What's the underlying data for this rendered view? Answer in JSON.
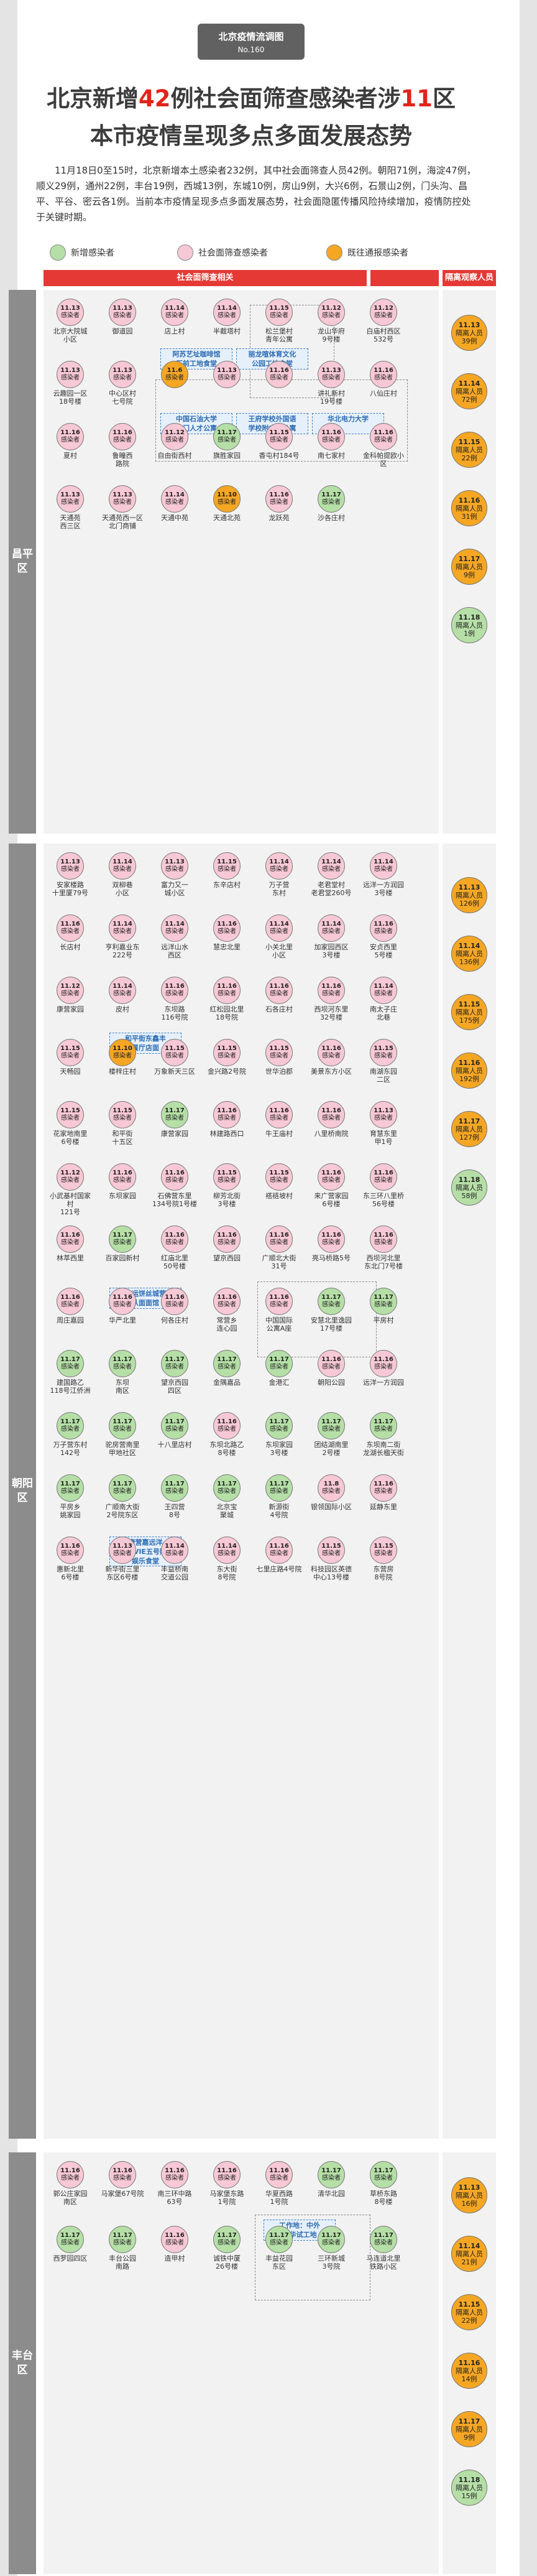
{
  "tag": {
    "title": "北京疫情流调图",
    "number": "No.160"
  },
  "headline": {
    "line1_a": "北京新增",
    "line1_n1": "42",
    "line1_b": "例社会面筛查感染者涉",
    "line1_n2": "11",
    "line1_c": "区",
    "line2": "本市疫情呈现多点多面发展态势"
  },
  "lead": "11月18日0至15时，北京新增本土感染者232例，其中社会面筛查人员42例。朝阳71例，海淀47例，顺义29例，通州22例，丰台19例，西城13例，东城10例，房山9例，大兴6例，石景山2例，门头沟、昌平、平谷、密云各1例。当前本市疫情呈现多点多面发展态势，社会面隐匿传播风险持续增加，疫情防控处于关键时期。",
  "legend": [
    {
      "label": "新增感染者",
      "color": "#b5dfa6"
    },
    {
      "label": "社会面筛查感染者",
      "color": "#f7c8d5"
    },
    {
      "label": "既往通报感染者",
      "color": "#f5a623"
    }
  ],
  "headers": {
    "society": "社会面筛查相关",
    "isolated": "隔离观察人员"
  },
  "districts": [
    {
      "name": "昌平区"
    },
    {
      "name": "朝阳区"
    },
    {
      "name": "丰台区"
    }
  ],
  "cells": [
    {
      "date": "11.13",
      "txt": "感染者",
      "label": "北京大院城\n小区",
      "c": "pink"
    },
    {
      "date": "11.13",
      "txt": "感染者",
      "label": "御道园",
      "c": "pink"
    },
    {
      "date": "11.14",
      "txt": "感染者",
      "label": "店上村",
      "c": "pink"
    },
    {
      "date": "11.14",
      "txt": "感染者",
      "label": "半截塔村",
      "c": "pink"
    },
    {
      "date": "11.15",
      "txt": "感染者",
      "label": "松兰堡村\n青年公寓",
      "c": "pink"
    },
    {
      "date": "11.12",
      "txt": "感染者",
      "label": "龙山华府\n9号楼",
      "c": "pink"
    },
    {
      "date": "11.12",
      "txt": "感染者",
      "label": "白庙村西区\n532号",
      "c": "pink"
    },
    {
      "date": "11.13",
      "txt": "感染者",
      "label": "云趣园一区\n18号楼",
      "c": "pink"
    },
    {
      "date": "11.13",
      "txt": "感染者",
      "label": "中心区村\n七号院",
      "c": "pink"
    },
    {
      "date": "11.6",
      "txt": "感染者",
      "label": "",
      "c": "orange"
    },
    {
      "date": "11.13",
      "txt": "感染者",
      "label": "",
      "c": "pink"
    },
    {
      "date": "11.16",
      "txt": "感染者",
      "label": "",
      "c": "pink"
    },
    {
      "date": "11.13",
      "txt": "感染者",
      "label": "讲礼新村\n19号楼",
      "c": "pink"
    },
    {
      "date": "11.16",
      "txt": "感染者",
      "label": "八仙庄村",
      "c": "pink"
    },
    {
      "date": "11.16",
      "txt": "感染者",
      "label": "夏村",
      "c": "pink"
    },
    {
      "date": "11.16",
      "txt": "感染者",
      "label": "鲁疃西\n路院",
      "c": "pink"
    },
    {
      "date": "11.12",
      "txt": "感染者",
      "label": "自由街西村",
      "c": "pink"
    },
    {
      "date": "11.17",
      "txt": "感染者",
      "label": "旗胜家园",
      "c": "green"
    },
    {
      "date": "11.15",
      "txt": "感染者",
      "label": "香屯村184号",
      "c": "pink"
    },
    {
      "date": "11.16",
      "txt": "感染者",
      "label": "南七家村",
      "c": "pink"
    },
    {
      "date": "11.16",
      "txt": "感染者",
      "label": "金科帕提欧小区",
      "c": "pink"
    },
    {
      "date": "11.13",
      "txt": "感染者",
      "label": "天通苑\n西三区",
      "c": "pink"
    },
    {
      "date": "11.13",
      "txt": "感染者",
      "label": "天通苑西一区\n北门商铺",
      "c": "pink"
    },
    {
      "date": "11.14",
      "txt": "感染者",
      "label": "天通中苑",
      "c": "pink"
    },
    {
      "date": "11.10",
      "txt": "感染者",
      "label": "天通北苑",
      "c": "orange"
    },
    {
      "date": "11.16",
      "txt": "感染者",
      "label": "龙跃苑",
      "c": "pink"
    },
    {
      "date": "11.17",
      "txt": "感染者",
      "label": "沙各庄村",
      "c": "green"
    },
    {
      "date": "11.13",
      "txt": "感染者",
      "label": "安家楼路\n十里厦79号",
      "c": "pink"
    },
    {
      "date": "11.14",
      "txt": "感染者",
      "label": "双柳巷\n小区",
      "c": "pink"
    },
    {
      "date": "11.13",
      "txt": "感染者",
      "label": "富力又一\n城小区",
      "c": "pink"
    },
    {
      "date": "11.15",
      "txt": "感染者",
      "label": "东辛店村",
      "c": "pink"
    },
    {
      "date": "11.14",
      "txt": "感染者",
      "label": "万子营\n东村",
      "c": "pink"
    },
    {
      "date": "11.14",
      "txt": "感染者",
      "label": "老君堂村\n老君堂260号",
      "c": "pink"
    },
    {
      "date": "11.14",
      "txt": "感染者",
      "label": "远洋一方润园\n3号楼",
      "c": "pink"
    },
    {
      "date": "11.16",
      "txt": "感染者",
      "label": "长店村",
      "c": "pink"
    },
    {
      "date": "11.14",
      "txt": "感染者",
      "label": "亨利嘉业东\n222号",
      "c": "pink"
    },
    {
      "date": "11.14",
      "txt": "感染者",
      "label": "远洋山水\n西区",
      "c": "pink"
    },
    {
      "date": "11.16",
      "txt": "感染者",
      "label": "慧忠北里",
      "c": "pink"
    },
    {
      "date": "11.14",
      "txt": "感染者",
      "label": "小关北里\n小区",
      "c": "pink"
    },
    {
      "date": "11.14",
      "txt": "感染者",
      "label": "加家园西区\n3号楼",
      "c": "pink"
    },
    {
      "date": "11.16",
      "txt": "感染者",
      "label": "安贞西里\n5号楼",
      "c": "pink"
    },
    {
      "date": "11.12",
      "txt": "感染者",
      "label": "康营家园",
      "c": "pink"
    },
    {
      "date": "11.14",
      "txt": "感染者",
      "label": "皮村",
      "c": "pink"
    },
    {
      "date": "11.16",
      "txt": "感染者",
      "label": "东坝路\n116号院",
      "c": "pink"
    },
    {
      "date": "11.16",
      "txt": "感染者",
      "label": "红松园北里\n18号院",
      "c": "pink"
    },
    {
      "date": "11.16",
      "txt": "感染者",
      "label": "石各庄村",
      "c": "pink"
    },
    {
      "date": "11.16",
      "txt": "感染者",
      "label": "西坝河东里\n32号楼",
      "c": "pink"
    },
    {
      "date": "11.14",
      "txt": "感染者",
      "label": "南太子庄\n北巷",
      "c": "pink"
    },
    {
      "date": "11.15",
      "txt": "感染者",
      "label": "天畅园",
      "c": "pink"
    },
    {
      "date": "11.10",
      "txt": "感染者",
      "label": "楼梓庄村",
      "c": "orange"
    },
    {
      "date": "11.15",
      "txt": "感染者",
      "label": "万象新天三区",
      "c": "pink"
    },
    {
      "date": "11.15",
      "txt": "感染者",
      "label": "金兴路2号院",
      "c": "pink"
    },
    {
      "date": "11.15",
      "txt": "感染者",
      "label": "世华泊郡",
      "c": "pink"
    },
    {
      "date": "11.16",
      "txt": "感染者",
      "label": "美景东方小区",
      "c": "pink"
    },
    {
      "date": "11.15",
      "txt": "感染者",
      "label": "南湖东园\n二区",
      "c": "pink"
    },
    {
      "date": "11.15",
      "txt": "感染者",
      "label": "花家地南里\n6号楼",
      "c": "pink"
    },
    {
      "date": "11.15",
      "txt": "感染者",
      "label": "和平街\n十五区",
      "c": "pink"
    },
    {
      "date": "11.17",
      "txt": "感染者",
      "label": "康营家园",
      "c": "green"
    },
    {
      "date": "11.16",
      "txt": "感染者",
      "label": "林建路西口",
      "c": "pink"
    },
    {
      "date": "11.16",
      "txt": "感染者",
      "label": "牛王庙村",
      "c": "pink"
    },
    {
      "date": "11.16",
      "txt": "感染者",
      "label": "八里桥南院",
      "c": "pink"
    },
    {
      "date": "11.13",
      "txt": "感染者",
      "label": "育慧东里\n甲1号",
      "c": "pink"
    },
    {
      "date": "11.12",
      "txt": "感染者",
      "label": "小武基村国家村\n121号",
      "c": "pink"
    },
    {
      "date": "11.16",
      "txt": "感染者",
      "label": "东坝家园",
      "c": "pink"
    },
    {
      "date": "11.16",
      "txt": "感染者",
      "label": "石佛营东里\n134号院1号楼",
      "c": "pink"
    },
    {
      "date": "11.15",
      "txt": "感染者",
      "label": "柳芳北街\n3号楼",
      "c": "pink"
    },
    {
      "date": "11.15",
      "txt": "感染者",
      "label": "褡裢坡村",
      "c": "pink"
    },
    {
      "date": "11.16",
      "txt": "感染者",
      "label": "来广营家园\n6号楼",
      "c": "pink"
    },
    {
      "date": "11.16",
      "txt": "感染者",
      "label": "东三环八里桥\n56号楼",
      "c": "pink"
    },
    {
      "date": "11.16",
      "txt": "感染者",
      "label": "林萃西里",
      "c": "pink"
    },
    {
      "date": "11.17",
      "txt": "感染者",
      "label": "百家园新村",
      "c": "green"
    },
    {
      "date": "11.16",
      "txt": "感染者",
      "label": "红庙北里\n50号楼",
      "c": "pink"
    },
    {
      "date": "11.16",
      "txt": "感染者",
      "label": "望京西园",
      "c": "pink"
    },
    {
      "date": "11.16",
      "txt": "感染者",
      "label": "广顺北大街\n31号",
      "c": "pink"
    },
    {
      "date": "11.16",
      "txt": "感染者",
      "label": "亮马桥路5号",
      "c": "pink"
    },
    {
      "date": "11.16",
      "txt": "感染者",
      "label": "西坝河北里\n东北门7号楼",
      "c": "pink"
    },
    {
      "date": "11.16",
      "txt": "感染者",
      "label": "周庄嘉园",
      "c": "pink"
    },
    {
      "date": "11.16",
      "txt": "感染者",
      "label": "华严北里",
      "c": "pink"
    },
    {
      "date": "11.16",
      "txt": "感染者",
      "label": "何各庄村",
      "c": "pink"
    },
    {
      "date": "11.16",
      "txt": "感染者",
      "label": "常营乡\n连心园",
      "c": "pink"
    },
    {
      "date": "11.16",
      "txt": "感染者",
      "label": "中国国际\n公寓A座",
      "c": "pink"
    },
    {
      "date": "11.17",
      "txt": "感染者",
      "label": "安慧北里逸园\n17号楼",
      "c": "green"
    },
    {
      "date": "11.17",
      "txt": "感染者",
      "label": "平房村",
      "c": "green"
    },
    {
      "date": "11.17",
      "txt": "感染者",
      "label": "建国路乙\n118号江侨洲",
      "c": "green"
    },
    {
      "date": "11.17",
      "txt": "感染者",
      "label": "东坝\n南区",
      "c": "green"
    },
    {
      "date": "11.17",
      "txt": "感染者",
      "label": "望京西园\n四区",
      "c": "green"
    },
    {
      "date": "11.17",
      "txt": "感染者",
      "label": "金隅嘉品",
      "c": "green"
    },
    {
      "date": "11.17",
      "txt": "感染者",
      "label": "金港汇",
      "c": "green"
    },
    {
      "date": "11.16",
      "txt": "感染者",
      "label": "朝阳公园",
      "c": "pink"
    },
    {
      "date": "11.16",
      "txt": "感染者",
      "label": "远洋一方润园",
      "c": "pink"
    },
    {
      "date": "11.17",
      "txt": "感染者",
      "label": "万子营东村\n142号",
      "c": "green"
    },
    {
      "date": "11.17",
      "txt": "感染者",
      "label": "驼房营南里\n甲地社区",
      "c": "green"
    },
    {
      "date": "11.17",
      "txt": "感染者",
      "label": "十八里店村",
      "c": "green"
    },
    {
      "date": "11.16",
      "txt": "感染者",
      "label": "东坝北路乙\n8号楼",
      "c": "pink"
    },
    {
      "date": "11.17",
      "txt": "感染者",
      "label": "东坝家园\n3号楼",
      "c": "green"
    },
    {
      "date": "11.17",
      "txt": "感染者",
      "label": "团结湖南里\n2号楼",
      "c": "green"
    },
    {
      "date": "11.17",
      "txt": "感染者",
      "label": "东坝南二街\n龙湖长楹天街",
      "c": "green"
    },
    {
      "date": "11.17",
      "txt": "感染者",
      "label": "平房乡\n姚家园",
      "c": "green"
    },
    {
      "date": "11.17",
      "txt": "感染者",
      "label": "广顺南大街\n2号院东区",
      "c": "green"
    },
    {
      "date": "11.17",
      "txt": "感染者",
      "label": "王四营\n8号",
      "c": "green"
    },
    {
      "date": "11.17",
      "txt": "感染者",
      "label": "北京宝\n聚城",
      "c": "green"
    },
    {
      "date": "11.17",
      "txt": "感染者",
      "label": "新源街\n4号院",
      "c": "green"
    },
    {
      "date": "11.8",
      "txt": "感染者",
      "label": "银领国际小区",
      "c": "pink"
    },
    {
      "date": "11.16",
      "txt": "感染者",
      "label": "延静东里",
      "c": "pink"
    },
    {
      "date": "11.16",
      "txt": "感染者",
      "label": "惠新北里\n6号楼",
      "c": "pink"
    },
    {
      "date": "11.13",
      "txt": "感染者",
      "label": "新华街三里\n东区6号楼",
      "c": "pink"
    },
    {
      "date": "11.14",
      "txt": "感染者",
      "label": "丰益桥南\n交道公园",
      "c": "pink"
    },
    {
      "date": "11.14",
      "txt": "感染者",
      "label": "东大街\n8号院",
      "c": "pink"
    },
    {
      "date": "11.16",
      "txt": "感染者",
      "label": "七里庄路4号院",
      "c": "pink"
    },
    {
      "date": "11.15",
      "txt": "感染者",
      "label": "科技园区英德\n中心13号楼",
      "c": "pink"
    },
    {
      "date": "11.15",
      "txt": "感染者",
      "label": "东营房\n8号院",
      "c": "pink"
    },
    {
      "date": "11.16",
      "txt": "感染者",
      "label": "郭公庄家园\n南区",
      "c": "pink"
    },
    {
      "date": "11.16",
      "txt": "感染者",
      "label": "马家堡67号院",
      "c": "pink"
    },
    {
      "date": "11.16",
      "txt": "感染者",
      "label": "南三环中路\n63号",
      "c": "pink"
    },
    {
      "date": "11.16",
      "txt": "感染者",
      "label": "马家堡东路\n1号院",
      "c": "pink"
    },
    {
      "date": "11.16",
      "txt": "感染者",
      "label": "华夏西路\n1号院",
      "c": "pink"
    },
    {
      "date": "11.17",
      "txt": "感染者",
      "label": "清华北园",
      "c": "green"
    },
    {
      "date": "11.17",
      "txt": "感染者",
      "label": "草桥东路\n8号楼",
      "c": "green"
    },
    {
      "date": "11.17",
      "txt": "感染者",
      "label": "西罗园四区",
      "c": "green"
    },
    {
      "date": "11.17",
      "txt": "感染者",
      "label": "丰台公园\n南路",
      "c": "green"
    },
    {
      "date": "11.16",
      "txt": "感染者",
      "label": "造甲村",
      "c": "pink"
    },
    {
      "date": "11.17",
      "txt": "感染者",
      "label": "诚铁中厦\n26号楼",
      "c": "green"
    },
    {
      "date": "11.17",
      "txt": "感染者",
      "label": "丰益花园\n东区",
      "c": "green"
    },
    {
      "date": "11.17",
      "txt": "感染者",
      "label": "三环新城\n3号院",
      "c": "green"
    },
    {
      "date": "11.17",
      "txt": "感染者",
      "label": "马连道北里\n铁路小区",
      "c": "green"
    }
  ],
  "iso": [
    {
      "date": "11.13",
      "txt": "隔离人员\n39例",
      "c": "orange"
    },
    {
      "date": "11.14",
      "txt": "隔离人员\n72例",
      "c": "orange"
    },
    {
      "date": "11.15",
      "txt": "隔离人员\n22例",
      "c": "orange"
    },
    {
      "date": "11.16",
      "txt": "隔离人员\n31例",
      "c": "orange"
    },
    {
      "date": "11.17",
      "txt": "隔离人员\n9例",
      "c": "orange"
    },
    {
      "date": "11.18",
      "txt": "隔离人员\n1例",
      "c": "green"
    },
    {
      "date": "11.13",
      "txt": "隔离人员\n126例",
      "c": "orange"
    },
    {
      "date": "11.14",
      "txt": "隔离人员\n136例",
      "c": "orange"
    },
    {
      "date": "11.15",
      "txt": "隔离人员\n175例",
      "c": "orange"
    },
    {
      "date": "11.16",
      "txt": "隔离人员\n192例",
      "c": "orange"
    },
    {
      "date": "11.17",
      "txt": "隔离人员\n127例",
      "c": "orange"
    },
    {
      "date": "11.18",
      "txt": "隔离人员\n58例",
      "c": "green"
    },
    {
      "date": "11.13",
      "txt": "隔离人员\n16例",
      "c": "orange"
    },
    {
      "date": "11.14",
      "txt": "隔离人员\n21例",
      "c": "orange"
    },
    {
      "date": "11.15",
      "txt": "隔离人员\n22例",
      "c": "orange"
    },
    {
      "date": "11.16",
      "txt": "隔离人员\n14例",
      "c": "orange"
    },
    {
      "date": "11.17",
      "txt": "隔离人员\n9例",
      "c": "orange"
    },
    {
      "date": "11.18",
      "txt": "隔离人员\n15例",
      "c": "green"
    }
  ],
  "workplaces": [
    "阿苏艺址咖啡馆\n厂前工地食堂",
    "丽龙喧体育文化\n公园工地食堂",
    "中国石油大学\n北门人才公寓",
    "王府学校外国语\n学校附中部公寓",
    "华北电力大学",
    "和平街东鑫丰\n餐厅店面",
    "鑫运饼丝城营\n队面面馆",
    "康营嘉远洋\nLAVIE五号院\n娱乐食堂",
    "工作地：中外\n建华试工地"
  ]
}
